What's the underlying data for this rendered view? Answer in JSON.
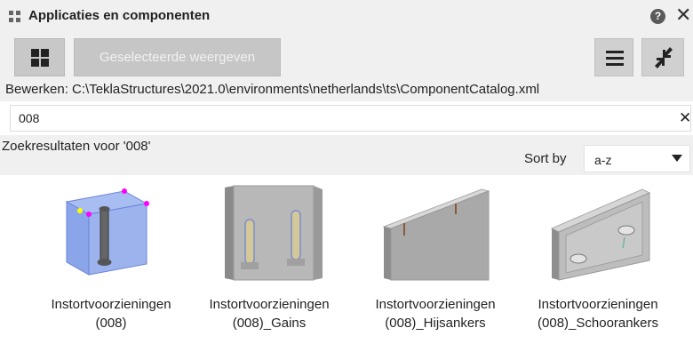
{
  "window": {
    "title": "Applicaties en componenten",
    "help_glyph": "?",
    "close_glyph": "✕"
  },
  "toolbar": {
    "show_selected_label": "Geselecteerde weergeven"
  },
  "path": {
    "text": "Bewerken:  C:\\TeklaStructures\\2021.0\\environments\\netherlands\\ts\\ComponentCatalog.xml"
  },
  "search": {
    "value": "008",
    "clear_glyph": "✕"
  },
  "results": {
    "label": "Zoekresultaten voor '008'",
    "sort_label": "Sort by",
    "sort_value": "a-z",
    "items": [
      {
        "line1": "Instortvoorzieningen",
        "line2": "(008)",
        "icon": "embedded-bolt-block-icon"
      },
      {
        "line1": "Instortvoorzieningen",
        "line2": "(008)_Gains",
        "icon": "wall-with-slots-icon"
      },
      {
        "line1": "Instortvoorzieningen",
        "line2": "(008)_Hijsankers",
        "icon": "wall-with-lifting-anchors-icon"
      },
      {
        "line1": "Instortvoorzieningen",
        "line2": "(008)_Schoorankers",
        "icon": "wall-with-brace-anchors-icon"
      }
    ]
  },
  "colors": {
    "panel_bg": "#f0f0f0",
    "highlight_blue": "#7f9fe6",
    "handle_magenta": "#ff00ff",
    "handle_yellow": "#ffff00"
  }
}
